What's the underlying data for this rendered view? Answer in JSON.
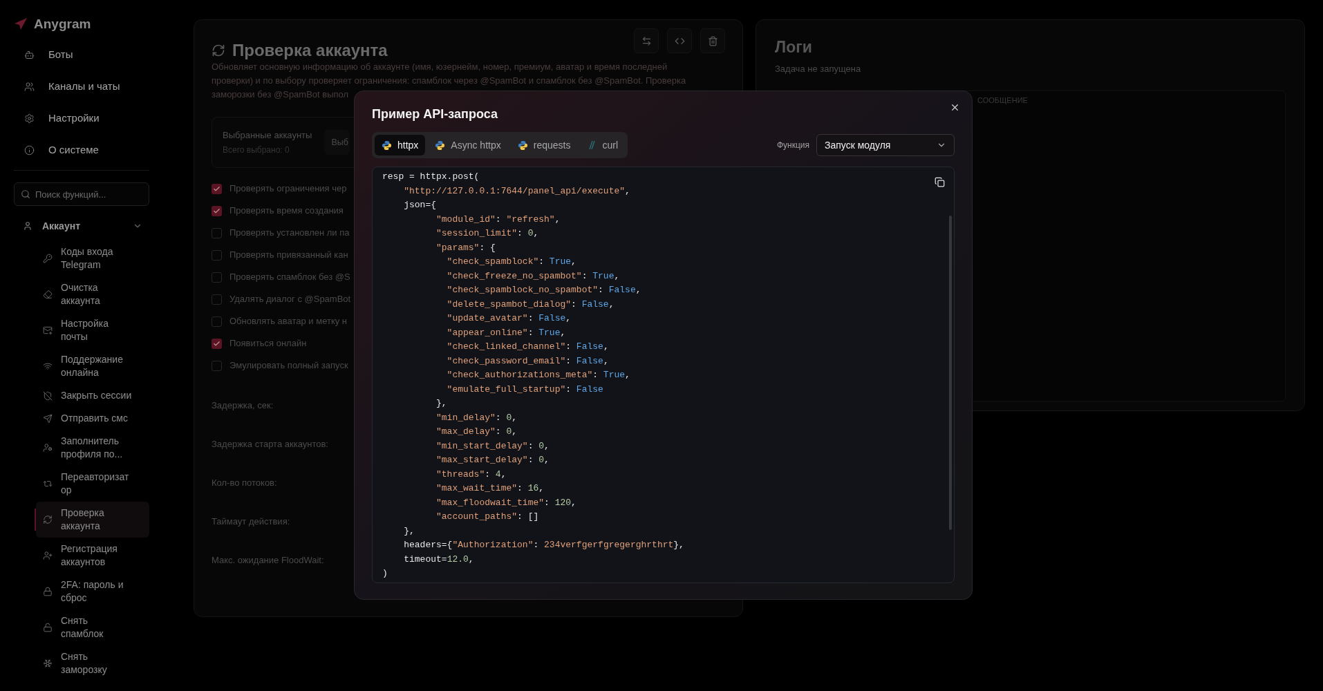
{
  "sidebar": {
    "logo": "Anygram",
    "nav": [
      {
        "label": "Боты"
      },
      {
        "label": "Каналы и чаты"
      },
      {
        "label": "Настройки"
      },
      {
        "label": "О системе"
      }
    ],
    "search": {
      "placeholder": "Поиск функций..."
    },
    "group": {
      "label": "Аккаунт",
      "expanded": true,
      "children": [
        {
          "label": "Коды входа Telegram",
          "selected": false
        },
        {
          "label": "Очистка аккаунта",
          "selected": false
        },
        {
          "label": "Настройка почты",
          "selected": false
        },
        {
          "label": "Поддержание онлайна",
          "selected": false
        },
        {
          "label": "Закрыть сессии",
          "selected": false
        },
        {
          "label": "Отправить смс",
          "selected": false
        },
        {
          "label": "Заполнитель профиля по...",
          "selected": false
        },
        {
          "label": "Переавторизатор",
          "selected": false
        },
        {
          "label": "Проверка аккаунта",
          "selected": true
        },
        {
          "label": "Регистрация аккаунтов",
          "selected": false
        },
        {
          "label": "2FA: пароль и сброс",
          "selected": false
        },
        {
          "label": "Снять спамблок",
          "selected": false
        },
        {
          "label": "Снять заморозку",
          "selected": false
        }
      ]
    }
  },
  "main": {
    "title": "Проверка аккаунта",
    "description_lines": [
      "Обновляет основную информацию об аккаунте (имя, юзернейм, номер, премиум, аватар и время последней",
      "проверки) и по выбору проверяет ограничения: спамблок через @SpamBot и спамблок без @SpamBot. Проверка",
      "заморозки без @SpamBot выпол"
    ],
    "selected_accounts": {
      "title": "Выбранные аккаунты",
      "count": "Всего выбрано: 0",
      "button": "Выб"
    },
    "options": [
      {
        "label": "Проверять ограничения чер",
        "checked": true
      },
      {
        "label": "Проверять время создания",
        "checked": true
      },
      {
        "label": "Проверять установлен ли па",
        "checked": false
      },
      {
        "label": "Проверять привязанный кан",
        "checked": false
      },
      {
        "label": "Проверять спамблок без @S",
        "checked": false
      },
      {
        "label": "Удалять диалог с @SpamBot",
        "checked": false
      },
      {
        "label": "Обновлять аватар и метку н",
        "checked": false
      },
      {
        "label": "Появиться онлайн",
        "checked": true
      },
      {
        "label": "Эмулировать полный запуск",
        "checked": false
      }
    ],
    "fields": [
      "Задержка, сек:",
      "Задержка старта аккаунтов:",
      "Кол-во потоков:",
      "Таймаут действия:",
      "Макс. ожидание FloodWait:"
    ]
  },
  "logs": {
    "title": "Логи",
    "status": "Задача не запущена",
    "columns": [
      "СООБЩЕНИЕ"
    ]
  },
  "modal": {
    "title": "Пример API-запроса",
    "tabs": [
      {
        "label": "httpx",
        "kind": "python",
        "selected": true
      },
      {
        "label": "Async httpx",
        "kind": "python",
        "selected": false
      },
      {
        "label": "requests",
        "kind": "python",
        "selected": false
      },
      {
        "label": "curl",
        "kind": "shell",
        "selected": false
      }
    ],
    "function_label": "Функция",
    "function_value": "Запуск модуля",
    "code": [
      [
        {
          "kind": "plain",
          "text": "resp = httpx.post("
        }
      ],
      [
        {
          "kind": "str",
          "text": "    \"http://127.0.0.1:7644/panel_api/execute\""
        },
        {
          "kind": "plain",
          "text": ","
        }
      ],
      [
        {
          "kind": "plain",
          "text": "    json={"
        }
      ],
      [
        {
          "kind": "str",
          "text": "          \"module_id\""
        },
        {
          "kind": "plain",
          "text": ": "
        },
        {
          "kind": "str",
          "text": "\"refresh\""
        },
        {
          "kind": "plain",
          "text": ","
        }
      ],
      [
        {
          "kind": "str",
          "text": "          \"session_limit\""
        },
        {
          "kind": "plain",
          "text": ": "
        },
        {
          "kind": "num",
          "text": "0"
        },
        {
          "kind": "plain",
          "text": ","
        }
      ],
      [
        {
          "kind": "str",
          "text": "          \"params\""
        },
        {
          "kind": "plain",
          "text": ": {"
        }
      ],
      [
        {
          "kind": "str",
          "text": "            \"check_spamblock\""
        },
        {
          "kind": "plain",
          "text": ": "
        },
        {
          "kind": "bool",
          "text": "True"
        },
        {
          "kind": "plain",
          "text": ","
        }
      ],
      [
        {
          "kind": "str",
          "text": "            \"check_freeze_no_spambot\""
        },
        {
          "kind": "plain",
          "text": ": "
        },
        {
          "kind": "bool",
          "text": "True"
        },
        {
          "kind": "plain",
          "text": ","
        }
      ],
      [
        {
          "kind": "str",
          "text": "            \"check_spamblock_no_spambot\""
        },
        {
          "kind": "plain",
          "text": ": "
        },
        {
          "kind": "bool",
          "text": "False"
        },
        {
          "kind": "plain",
          "text": ","
        }
      ],
      [
        {
          "kind": "str",
          "text": "            \"delete_spambot_dialog\""
        },
        {
          "kind": "plain",
          "text": ": "
        },
        {
          "kind": "bool",
          "text": "False"
        },
        {
          "kind": "plain",
          "text": ","
        }
      ],
      [
        {
          "kind": "str",
          "text": "            \"update_avatar\""
        },
        {
          "kind": "plain",
          "text": ": "
        },
        {
          "kind": "bool",
          "text": "False"
        },
        {
          "kind": "plain",
          "text": ","
        }
      ],
      [
        {
          "kind": "str",
          "text": "            \"appear_online\""
        },
        {
          "kind": "plain",
          "text": ": "
        },
        {
          "kind": "bool",
          "text": "True"
        },
        {
          "kind": "plain",
          "text": ","
        }
      ],
      [
        {
          "kind": "str",
          "text": "            \"check_linked_channel\""
        },
        {
          "kind": "plain",
          "text": ": "
        },
        {
          "kind": "bool",
          "text": "False"
        },
        {
          "kind": "plain",
          "text": ","
        }
      ],
      [
        {
          "kind": "str",
          "text": "            \"check_password_email\""
        },
        {
          "kind": "plain",
          "text": ": "
        },
        {
          "kind": "bool",
          "text": "False"
        },
        {
          "kind": "plain",
          "text": ","
        }
      ],
      [
        {
          "kind": "str",
          "text": "            \"check_authorizations_meta\""
        },
        {
          "kind": "plain",
          "text": ": "
        },
        {
          "kind": "bool",
          "text": "True"
        },
        {
          "kind": "plain",
          "text": ","
        }
      ],
      [
        {
          "kind": "str",
          "text": "            \"emulate_full_startup\""
        },
        {
          "kind": "plain",
          "text": ": "
        },
        {
          "kind": "bool",
          "text": "False"
        }
      ],
      [
        {
          "kind": "plain",
          "text": "          },"
        }
      ],
      [
        {
          "kind": "str",
          "text": "          \"min_delay\""
        },
        {
          "kind": "plain",
          "text": ": "
        },
        {
          "kind": "num",
          "text": "0"
        },
        {
          "kind": "plain",
          "text": ","
        }
      ],
      [
        {
          "kind": "str",
          "text": "          \"max_delay\""
        },
        {
          "kind": "plain",
          "text": ": "
        },
        {
          "kind": "num",
          "text": "0"
        },
        {
          "kind": "plain",
          "text": ","
        }
      ],
      [
        {
          "kind": "str",
          "text": "          \"min_start_delay\""
        },
        {
          "kind": "plain",
          "text": ": "
        },
        {
          "kind": "num",
          "text": "0"
        },
        {
          "kind": "plain",
          "text": ","
        }
      ],
      [
        {
          "kind": "str",
          "text": "          \"max_start_delay\""
        },
        {
          "kind": "plain",
          "text": ": "
        },
        {
          "kind": "num",
          "text": "0"
        },
        {
          "kind": "plain",
          "text": ","
        }
      ],
      [
        {
          "kind": "str",
          "text": "          \"threads\""
        },
        {
          "kind": "plain",
          "text": ": "
        },
        {
          "kind": "num",
          "text": "4"
        },
        {
          "kind": "plain",
          "text": ","
        }
      ],
      [
        {
          "kind": "str",
          "text": "          \"max_wait_time\""
        },
        {
          "kind": "plain",
          "text": ": "
        },
        {
          "kind": "num",
          "text": "16"
        },
        {
          "kind": "plain",
          "text": ","
        }
      ],
      [
        {
          "kind": "str",
          "text": "          \"max_floodwait_time\""
        },
        {
          "kind": "plain",
          "text": ": "
        },
        {
          "kind": "num",
          "text": "120"
        },
        {
          "kind": "plain",
          "text": ","
        }
      ],
      [
        {
          "kind": "str",
          "text": "          \"account_paths\""
        },
        {
          "kind": "plain",
          "text": ": []"
        }
      ],
      [
        {
          "kind": "plain",
          "text": "    },"
        }
      ],
      [
        {
          "kind": "plain",
          "text": "    headers={"
        },
        {
          "kind": "str",
          "text": "\"Authorization\""
        },
        {
          "kind": "plain",
          "text": ": "
        },
        {
          "kind": "str",
          "text": "234verfgerfgregerghrthrt"
        },
        {
          "kind": "plain",
          "text": "},"
        }
      ],
      [
        {
          "kind": "plain",
          "text": "    timeout="
        },
        {
          "kind": "num",
          "text": "12.0"
        },
        {
          "kind": "plain",
          "text": ","
        }
      ],
      [
        {
          "kind": "plain",
          "text": ")"
        }
      ]
    ]
  }
}
